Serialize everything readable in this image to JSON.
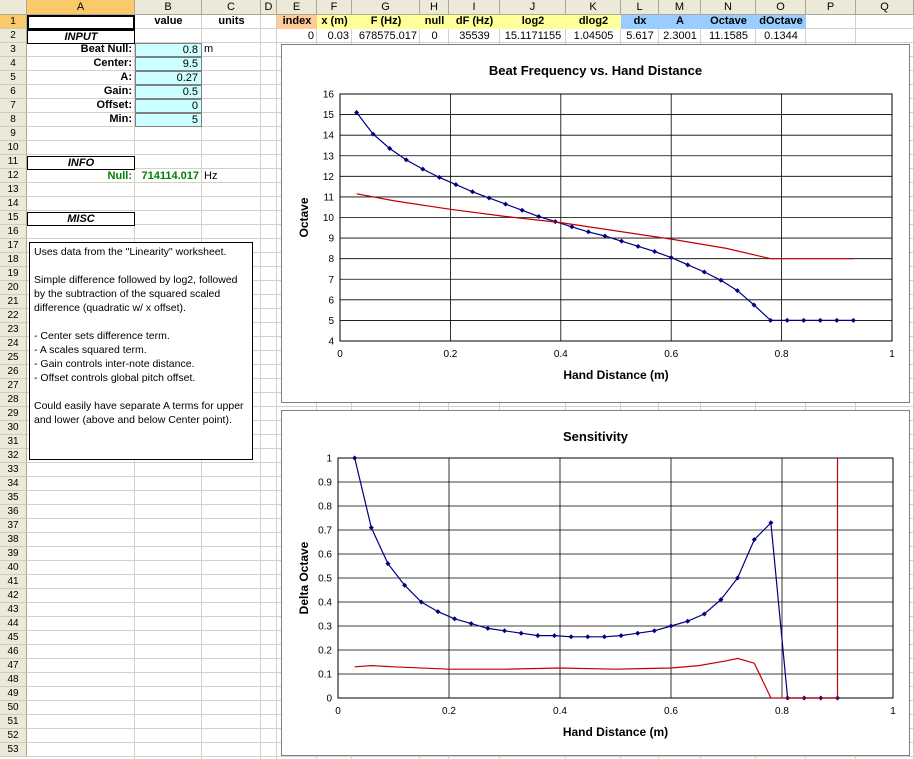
{
  "sheet": {
    "columns": [
      "A",
      "B",
      "C",
      "D",
      "E",
      "F",
      "G",
      "H",
      "I",
      "J",
      "K",
      "L",
      "M",
      "N",
      "O",
      "P",
      "Q"
    ],
    "rows": [
      "1",
      "2",
      "3",
      "4",
      "5",
      "6",
      "7",
      "8",
      "9",
      "10",
      "11",
      "12",
      "13",
      "14",
      "15",
      "16",
      "17",
      "18",
      "19",
      "20",
      "21",
      "22",
      "23",
      "24",
      "25",
      "26",
      "27",
      "28",
      "29",
      "30",
      "31",
      "32",
      "33",
      "34",
      "35",
      "36",
      "37",
      "38",
      "39",
      "40",
      "41",
      "42",
      "43",
      "44",
      "45",
      "46",
      "47",
      "48",
      "49",
      "50",
      "51",
      "52",
      "53"
    ],
    "header_row": {
      "value": "value",
      "units": "units",
      "index": "index",
      "x": "x (m)",
      "f": "F (Hz)",
      "null": "null",
      "df": "dF (Hz)",
      "log2": "log2",
      "dlog2": "dlog2",
      "dx": "dx",
      "a": "A",
      "octave": "Octave",
      "doctave": "dOctave"
    },
    "row2": {
      "index": "0",
      "x": "0.03",
      "f": "678575.017",
      "null": "0",
      "df": "35539",
      "log2": "15.1171155",
      "dlog2": "1.04505",
      "dx": "5.617",
      "a": "2.3001",
      "octave": "11.1585",
      "doctave": "0.1344"
    },
    "input_title": "INPUT",
    "params": [
      {
        "label": "Beat Null:",
        "value": "0.8",
        "unit": "m"
      },
      {
        "label": "Center:",
        "value": "9.5",
        "unit": ""
      },
      {
        "label": "A:",
        "value": "0.27",
        "unit": ""
      },
      {
        "label": "Gain:",
        "value": "0.5",
        "unit": ""
      },
      {
        "label": "Offset:",
        "value": "0",
        "unit": ""
      },
      {
        "label": "Min:",
        "value": "5",
        "unit": ""
      }
    ],
    "info_title": "INFO",
    "null_label": "Null:",
    "null_value": "714114.017",
    "null_unit": "Hz",
    "misc_title": "MISC",
    "notes": "Uses data from the \"Linearity\" worksheet.\n\nSimple difference followed by log2, followed by the subtraction of the squared scaled difference (quadratic w/ x offset).\n\n- Center sets difference term.\n- A scales squared term.\n- Gain controls inter-note distance.\n- Offset controls global pitch offset.\n\nCould easily have separate A terms for upper and lower (above and below Center point)."
  },
  "colors": {
    "blue_series": "#000080",
    "red_series": "#c00000",
    "input_fill": "#ccffff",
    "null_value_text": "#008000"
  },
  "chart_data": [
    {
      "type": "line",
      "title": "Beat Frequency vs. Hand Distance",
      "xlabel": "Hand Distance (m)",
      "ylabel": "Octave",
      "xlim": [
        0,
        1
      ],
      "ylim": [
        4,
        16
      ],
      "xticks": [
        "0",
        "0.2",
        "0.4",
        "0.6",
        "0.8",
        "1"
      ],
      "yticks": [
        "4",
        "5",
        "6",
        "7",
        "8",
        "9",
        "10",
        "11",
        "12",
        "13",
        "14",
        "15",
        "16"
      ],
      "grid": true,
      "legend": "none",
      "series": [
        {
          "color": "#000080",
          "markers": true,
          "x": [
            0.03,
            0.06,
            0.09,
            0.12,
            0.15,
            0.18,
            0.21,
            0.24,
            0.27,
            0.3,
            0.33,
            0.36,
            0.39,
            0.42,
            0.45,
            0.48,
            0.51,
            0.54,
            0.57,
            0.6,
            0.63,
            0.66,
            0.69,
            0.72,
            0.75,
            0.78,
            0.81,
            0.84,
            0.87,
            0.9,
            0.93
          ],
          "y": [
            15.1,
            14.05,
            13.35,
            12.8,
            12.35,
            11.95,
            11.6,
            11.25,
            10.95,
            10.65,
            10.35,
            10.05,
            9.8,
            9.55,
            9.3,
            9.1,
            8.85,
            8.6,
            8.35,
            8.05,
            7.7,
            7.35,
            6.95,
            6.45,
            5.75,
            5.0,
            5.0,
            5.0,
            5.0,
            5.0,
            5.0
          ]
        },
        {
          "color": "#c00000",
          "markers": false,
          "x": [
            0.03,
            0.1,
            0.2,
            0.3,
            0.4,
            0.5,
            0.6,
            0.7,
            0.78,
            0.81,
            0.93
          ],
          "y": [
            11.15,
            10.8,
            10.4,
            10.05,
            9.75,
            9.35,
            8.95,
            8.5,
            8.0,
            8.0,
            8.0
          ]
        }
      ]
    },
    {
      "type": "line",
      "title": "Sensitivity",
      "xlabel": "Hand Distance (m)",
      "ylabel": "Delta Octave",
      "xlim": [
        0,
        1
      ],
      "ylim": [
        0,
        1
      ],
      "xticks": [
        "0",
        "0.2",
        "0.4",
        "0.6",
        "0.8",
        "1"
      ],
      "yticks": [
        "0",
        "0.1",
        "0.2",
        "0.3",
        "0.4",
        "0.5",
        "0.6",
        "0.7",
        "0.8",
        "0.9",
        "1"
      ],
      "grid": true,
      "legend": "none",
      "series": [
        {
          "color": "#000080",
          "markers": true,
          "x": [
            0.03,
            0.06,
            0.09,
            0.12,
            0.15,
            0.18,
            0.21,
            0.24,
            0.27,
            0.3,
            0.33,
            0.36,
            0.39,
            0.42,
            0.45,
            0.48,
            0.51,
            0.54,
            0.57,
            0.6,
            0.63,
            0.66,
            0.69,
            0.72,
            0.75,
            0.78,
            0.81,
            0.84,
            0.87,
            0.9
          ],
          "y": [
            1.0,
            0.71,
            0.56,
            0.47,
            0.4,
            0.36,
            0.33,
            0.31,
            0.29,
            0.28,
            0.27,
            0.26,
            0.26,
            0.255,
            0.255,
            0.255,
            0.26,
            0.27,
            0.28,
            0.3,
            0.32,
            0.35,
            0.41,
            0.5,
            0.66,
            0.73,
            0.0,
            0.0,
            0.0,
            0.0
          ]
        },
        {
          "color": "#c00000",
          "markers": false,
          "x": [
            0.03,
            0.06,
            0.1,
            0.2,
            0.3,
            0.4,
            0.5,
            0.6,
            0.65,
            0.7,
            0.72,
            0.75,
            0.78,
            0.81,
            0.9,
            0.9
          ],
          "y": [
            0.13,
            0.135,
            0.13,
            0.12,
            0.12,
            0.125,
            0.12,
            0.125,
            0.135,
            0.155,
            0.165,
            0.145,
            0.0,
            0.0,
            0.0,
            1.0
          ]
        }
      ]
    }
  ]
}
